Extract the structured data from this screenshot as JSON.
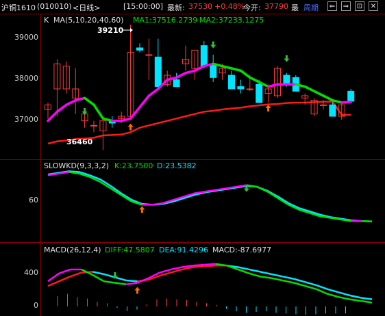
{
  "header": {
    "contract": "沪铜1610",
    "code": "(010010)",
    "period": "<日线>",
    "time": "[15:00:00]",
    "last_label": "最新:",
    "last_value": "37530",
    "change": "+0.48%",
    "open_label": "今开:",
    "open_value": "37790",
    "high_label": "最",
    "cycle_label": "周期",
    "btn_back": "⇐",
    "btn_fwd": "⇒",
    "btn_pin": "⊡",
    "btn_close": "✕"
  },
  "main_panel": {
    "indicator": "K",
    "ma_params": "MA(5,10,20,40,60)",
    "ma1": "MA1:37516.2739",
    "ma2": "MA2:37233.1275",
    "y_labels": [
      "39000",
      "38000",
      "37000"
    ],
    "high_annotation": "39210",
    "low_annotation": "36460"
  },
  "kd_panel": {
    "params": "SLOWKD(9,3,3,2)",
    "k": "K:23.7500",
    "d": "D:23.5382",
    "y_labels": [
      "60"
    ]
  },
  "macd_panel": {
    "params": "MACD(26,12,4)",
    "diff": "DIFF:47.5807",
    "dea": "DEA:91.4296",
    "macd": "MACD:-87.6977",
    "y_labels": [
      "400",
      "0"
    ]
  },
  "colors": {
    "up": "#ff3b3b",
    "down": "#00e5ff",
    "ma1": "#00e000",
    "ma1_alt": "#ff00ff",
    "ma2": "#ff1a1a",
    "axis": "#8b0000"
  },
  "chart_data": {
    "type": "candlestick",
    "ylim": [
      36300,
      39300
    ],
    "candles": [
      {
        "o": 37350,
        "h": 37500,
        "l": 37150,
        "c": 37450
      },
      {
        "o": 37800,
        "h": 38450,
        "l": 37200,
        "c": 38350
      },
      {
        "o": 37800,
        "h": 38400,
        "l": 37700,
        "c": 38300
      },
      {
        "o": 37600,
        "h": 38250,
        "l": 37250,
        "c": 37800
      },
      {
        "o": 37100,
        "h": 37350,
        "l": 36950,
        "c": 37250
      },
      {
        "o": 36990,
        "h": 37100,
        "l": 36850,
        "c": 37000
      },
      {
        "o": 36880,
        "h": 37100,
        "l": 36460,
        "c": 37100
      },
      {
        "o": 37100,
        "h": 37200,
        "l": 36950,
        "c": 37050
      },
      {
        "o": 37150,
        "h": 37300,
        "l": 37050,
        "c": 37200
      },
      {
        "o": 37200,
        "h": 39210,
        "l": 37150,
        "c": 38600
      },
      {
        "o": 38700,
        "h": 38800,
        "l": 38600,
        "c": 38650
      },
      {
        "o": 38550,
        "h": 38900,
        "l": 38000,
        "c": 38550
      },
      {
        "o": 38500,
        "h": 38900,
        "l": 37800,
        "c": 37850
      },
      {
        "o": 37900,
        "h": 38200,
        "l": 37850,
        "c": 38100
      },
      {
        "o": 38000,
        "h": 38150,
        "l": 37850,
        "c": 37850
      },
      {
        "o": 38350,
        "h": 38750,
        "l": 38200,
        "c": 38450
      },
      {
        "o": 38250,
        "h": 38600,
        "l": 38000,
        "c": 38650
      },
      {
        "o": 38750,
        "h": 38850,
        "l": 38250,
        "c": 38300
      },
      {
        "o": 38350,
        "h": 38550,
        "l": 37950,
        "c": 38050
      },
      {
        "o": 38150,
        "h": 38350,
        "l": 38000,
        "c": 38250
      },
      {
        "o": 38100,
        "h": 38200,
        "l": 37800,
        "c": 37800
      },
      {
        "o": 37850,
        "h": 38000,
        "l": 37700,
        "c": 37800
      },
      {
        "o": 37800,
        "h": 38100,
        "l": 37750,
        "c": 37800
      },
      {
        "o": 37900,
        "h": 38000,
        "l": 37500,
        "c": 37500
      },
      {
        "o": 37700,
        "h": 37900,
        "l": 37500,
        "c": 37800
      },
      {
        "o": 37650,
        "h": 38300,
        "l": 37600,
        "c": 38250
      },
      {
        "o": 38100,
        "h": 38150,
        "l": 37850,
        "c": 37900
      },
      {
        "o": 38050,
        "h": 38100,
        "l": 37750,
        "c": 37750
      },
      {
        "o": 37600,
        "h": 37700,
        "l": 37450,
        "c": 37650
      },
      {
        "o": 37250,
        "h": 37600,
        "l": 37200,
        "c": 37550
      },
      {
        "o": 37450,
        "h": 37550,
        "l": 37350,
        "c": 37450
      },
      {
        "o": 37450,
        "h": 37500,
        "l": 37200,
        "c": 37200
      },
      {
        "o": 37200,
        "h": 37500,
        "l": 37120,
        "c": 37450
      },
      {
        "o": 37750,
        "h": 37800,
        "l": 37500,
        "c": 37530
      }
    ],
    "ma1": [
      37100,
      37300,
      37450,
      37550,
      37600,
      37450,
      37150,
      37100,
      37100,
      37150,
      37400,
      37650,
      37800,
      38000,
      38050,
      38150,
      38200,
      38300,
      38350,
      38300,
      38250,
      38200,
      38050,
      37950,
      37850,
      37900,
      37900,
      37900,
      37850,
      37750,
      37650,
      37550,
      37500,
      37516
    ],
    "ma2": [
      36600,
      36650,
      36670,
      36700,
      36710,
      36730,
      36780,
      36790,
      36800,
      36850,
      36950,
      37000,
      37050,
      37100,
      37150,
      37200,
      37250,
      37300,
      37320,
      37350,
      37370,
      37390,
      37420,
      37440,
      37460,
      37470,
      37490,
      37500,
      37500,
      37510,
      37520,
      37520,
      37230,
      37233
    ],
    "slowkd": {
      "k": [
        80,
        82,
        84,
        82,
        78,
        72,
        64,
        56,
        48,
        44,
        44,
        46,
        50,
        54,
        58,
        60,
        62,
        64,
        66,
        68,
        66,
        60,
        52,
        44,
        38,
        34,
        30,
        28,
        26,
        24,
        24,
        23.75
      ],
      "d": [
        81,
        83,
        85,
        84,
        80,
        75,
        67,
        58,
        50,
        45,
        44,
        45,
        48,
        52,
        56,
        59,
        61,
        63,
        65,
        67,
        66,
        61,
        54,
        46,
        40,
        36,
        32,
        29,
        27,
        25,
        24,
        23.54
      ]
    },
    "macd": {
      "diff": [
        320,
        420,
        470,
        470,
        400,
        320,
        300,
        280,
        300,
        360,
        430,
        470,
        500,
        520,
        530,
        540,
        520,
        470,
        420,
        380,
        360,
        330,
        300,
        260,
        220,
        160,
        120,
        90,
        70,
        47.58
      ],
      "dea": [
        260,
        320,
        380,
        430,
        440,
        410,
        370,
        330,
        320,
        340,
        390,
        430,
        470,
        500,
        510,
        520,
        520,
        500,
        470,
        440,
        410,
        380,
        350,
        310,
        270,
        220,
        180,
        140,
        110,
        91.43
      ],
      "bars": [
        130,
        160,
        120,
        100,
        60,
        40,
        -20,
        -60,
        -40,
        30,
        90,
        100,
        90,
        80,
        60,
        40,
        20,
        -30,
        -60,
        -80,
        -70,
        -60,
        -80,
        -90,
        -100,
        -110,
        -100,
        -90,
        -90,
        -87.7
      ]
    }
  }
}
